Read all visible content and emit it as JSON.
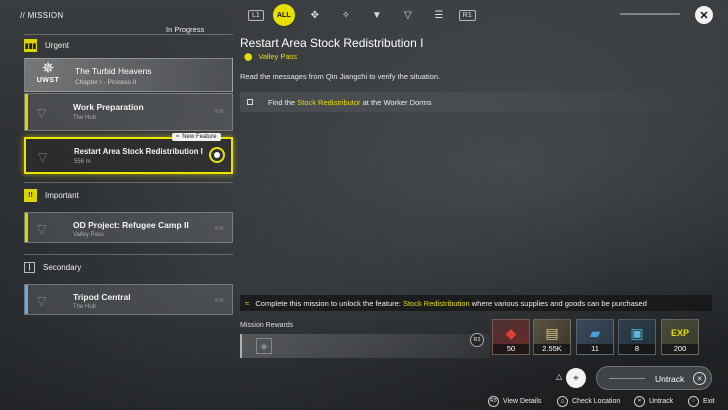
{
  "header": {
    "title": "// MISSION",
    "tabs": [
      {
        "key": "L1"
      },
      {
        "label": "ALL",
        "active": true
      },
      {
        "icon": "category-1-icon"
      },
      {
        "icon": "category-2-icon"
      },
      {
        "icon": "category-3-icon"
      },
      {
        "icon": "category-4-icon"
      },
      {
        "icon": "category-5-icon"
      },
      {
        "key": "R1"
      }
    ],
    "tab_left_key": "L1",
    "tab_all": "ALL",
    "tab_right_key": "R1",
    "close_icon": "close-icon"
  },
  "sidebar": {
    "in_progress_label": "In Progress",
    "urgent": {
      "label": "Urgent",
      "chapter": {
        "title": "The Turbid Heavens",
        "subtitle": "Chapter I - Process II",
        "logo_text": "UWST"
      },
      "missions": [
        {
          "title": "Work Preparation",
          "location": "The Hub"
        },
        {
          "title": "Restart Area Stock Redistribution I",
          "distance": "556 m",
          "badge": "New Feature",
          "selected": true
        }
      ]
    },
    "important": {
      "label": "Important",
      "missions": [
        {
          "title": "OD Project: Refugee Camp II",
          "location": "Valley Pass"
        }
      ]
    },
    "secondary": {
      "label": "Secondary",
      "missions": [
        {
          "title": "Tripod Central",
          "location": "The Hub"
        }
      ]
    }
  },
  "detail": {
    "title": "Restart Area Stock Redistribution I",
    "location": "Valley Pass",
    "description": "Read the messages from Qin Jiangchi to verify the situation.",
    "objective": {
      "pre": "Find the ",
      "highlight": "Stock Redistributor",
      "post": " at the Worker Dorms"
    },
    "unlock": {
      "pre": "Complete this mission to unlock the feature: ",
      "highlight": "Stock Redistribution",
      "post": " where various supplies and goods can be purchased"
    },
    "rewards_label": "Mission Rewards",
    "rewards_key": "R3",
    "rewards": [
      {
        "icon": "red-crystal-icon",
        "count": "50",
        "color": "#c0392b"
      },
      {
        "icon": "gold-bars-icon",
        "count": "2.55K",
        "color": "#c9b06a"
      },
      {
        "icon": "blue-ticket-icon",
        "count": "11",
        "color": "#3a8fc9"
      },
      {
        "icon": "tech-kit-icon",
        "count": "8",
        "color": "#4aa3c8"
      },
      {
        "icon": "exp-icon",
        "count": "200",
        "color": "#e6de00"
      }
    ]
  },
  "actions": {
    "untrack_label": "Untrack",
    "footer": [
      {
        "key": "R3",
        "label": "View Details"
      },
      {
        "key": "△",
        "label": "Check Location"
      },
      {
        "key": "✕",
        "label": "Untrack"
      },
      {
        "key": "○",
        "label": "Exit"
      }
    ]
  },
  "colors": {
    "accent": "#e6de00",
    "secondary": "#5ab0e0"
  }
}
